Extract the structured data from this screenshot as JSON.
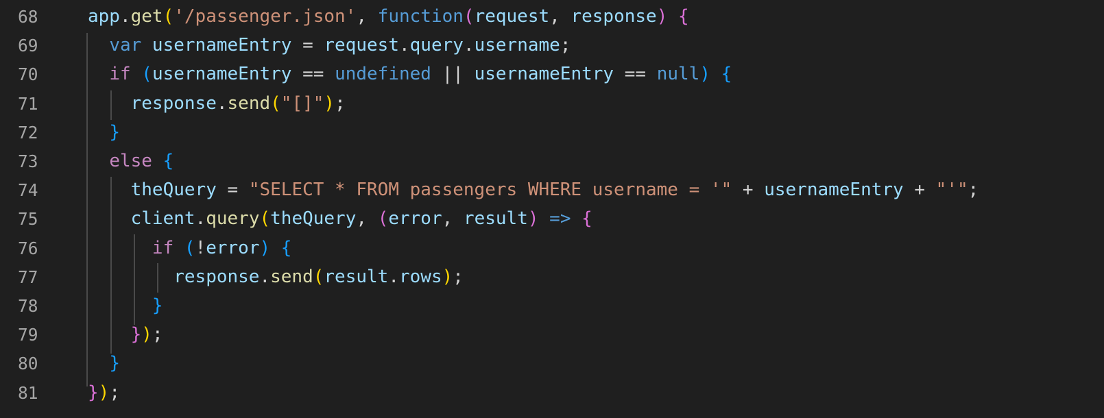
{
  "editor": {
    "language": "javascript",
    "theme_colors": {
      "background": "#1f1f1f",
      "line_number": "#a6a6a6",
      "variable": "#9cdcfe",
      "function": "#dcdcaa",
      "string": "#ce9178",
      "keyword_control": "#c586c0",
      "keyword_storage": "#569cd6",
      "punctuation": "#d4d4d4",
      "bracket_gold": "#ffd700",
      "bracket_pink": "#da70d6",
      "bracket_blue": "#179fff"
    },
    "lines": [
      {
        "number": "68",
        "tokens": [
          {
            "text": "app",
            "kind": "var"
          },
          {
            "text": ".",
            "kind": "punct"
          },
          {
            "text": "get",
            "kind": "func"
          },
          {
            "text": "(",
            "kind": "b1"
          },
          {
            "text": "'/passenger.json'",
            "kind": "str"
          },
          {
            "text": ", ",
            "kind": "punct"
          },
          {
            "text": "function",
            "kind": "storage"
          },
          {
            "text": "(",
            "kind": "b2"
          },
          {
            "text": "request",
            "kind": "var"
          },
          {
            "text": ", ",
            "kind": "punct"
          },
          {
            "text": "response",
            "kind": "var"
          },
          {
            "text": ")",
            "kind": "b2"
          },
          {
            "text": " ",
            "kind": "punct"
          },
          {
            "text": "{",
            "kind": "b2"
          }
        ]
      },
      {
        "number": "69",
        "tokens": [
          {
            "text": "  ",
            "kind": "punct"
          },
          {
            "text": "var",
            "kind": "storage"
          },
          {
            "text": " usernameEntry",
            "kind": "var"
          },
          {
            "text": " = ",
            "kind": "punct"
          },
          {
            "text": "request",
            "kind": "var"
          },
          {
            "text": ".",
            "kind": "punct"
          },
          {
            "text": "query",
            "kind": "var"
          },
          {
            "text": ".",
            "kind": "punct"
          },
          {
            "text": "username",
            "kind": "var"
          },
          {
            "text": ";",
            "kind": "punct"
          }
        ]
      },
      {
        "number": "70",
        "tokens": [
          {
            "text": "  ",
            "kind": "punct"
          },
          {
            "text": "if",
            "kind": "control"
          },
          {
            "text": " ",
            "kind": "punct"
          },
          {
            "text": "(",
            "kind": "b3"
          },
          {
            "text": "usernameEntry",
            "kind": "var"
          },
          {
            "text": " == ",
            "kind": "punct"
          },
          {
            "text": "undefined",
            "kind": "storage"
          },
          {
            "text": " || ",
            "kind": "punct"
          },
          {
            "text": "usernameEntry",
            "kind": "var"
          },
          {
            "text": " == ",
            "kind": "punct"
          },
          {
            "text": "null",
            "kind": "storage"
          },
          {
            "text": ")",
            "kind": "b3"
          },
          {
            "text": " ",
            "kind": "punct"
          },
          {
            "text": "{",
            "kind": "b3"
          }
        ]
      },
      {
        "number": "71",
        "tokens": [
          {
            "text": "    ",
            "kind": "punct"
          },
          {
            "text": "response",
            "kind": "var"
          },
          {
            "text": ".",
            "kind": "punct"
          },
          {
            "text": "send",
            "kind": "func"
          },
          {
            "text": "(",
            "kind": "b1"
          },
          {
            "text": "\"[]\"",
            "kind": "str"
          },
          {
            "text": ")",
            "kind": "b1"
          },
          {
            "text": ";",
            "kind": "punct"
          }
        ]
      },
      {
        "number": "72",
        "tokens": [
          {
            "text": "  ",
            "kind": "punct"
          },
          {
            "text": "}",
            "kind": "b3"
          }
        ]
      },
      {
        "number": "73",
        "tokens": [
          {
            "text": "  ",
            "kind": "punct"
          },
          {
            "text": "else",
            "kind": "control"
          },
          {
            "text": " ",
            "kind": "punct"
          },
          {
            "text": "{",
            "kind": "b3"
          }
        ]
      },
      {
        "number": "74",
        "tokens": [
          {
            "text": "    ",
            "kind": "punct"
          },
          {
            "text": "theQuery",
            "kind": "var"
          },
          {
            "text": " = ",
            "kind": "punct"
          },
          {
            "text": "\"SELECT * FROM passengers WHERE username = '\"",
            "kind": "str"
          },
          {
            "text": " + ",
            "kind": "punct"
          },
          {
            "text": "usernameEntry",
            "kind": "var"
          },
          {
            "text": " + ",
            "kind": "punct"
          },
          {
            "text": "\"'\"",
            "kind": "str"
          },
          {
            "text": ";",
            "kind": "punct"
          }
        ]
      },
      {
        "number": "75",
        "tokens": [
          {
            "text": "    ",
            "kind": "punct"
          },
          {
            "text": "client",
            "kind": "var_blue"
          },
          {
            "text": ".",
            "kind": "punct"
          },
          {
            "text": "query",
            "kind": "func"
          },
          {
            "text": "(",
            "kind": "b1"
          },
          {
            "text": "theQuery",
            "kind": "var"
          },
          {
            "text": ", ",
            "kind": "punct"
          },
          {
            "text": "(",
            "kind": "b2"
          },
          {
            "text": "error",
            "kind": "var"
          },
          {
            "text": ", ",
            "kind": "punct"
          },
          {
            "text": "result",
            "kind": "var"
          },
          {
            "text": ")",
            "kind": "b2"
          },
          {
            "text": " ",
            "kind": "punct"
          },
          {
            "text": "=>",
            "kind": "storage"
          },
          {
            "text": " ",
            "kind": "punct"
          },
          {
            "text": "{",
            "kind": "b2"
          }
        ]
      },
      {
        "number": "76",
        "tokens": [
          {
            "text": "      ",
            "kind": "punct"
          },
          {
            "text": "if",
            "kind": "control"
          },
          {
            "text": " ",
            "kind": "punct"
          },
          {
            "text": "(",
            "kind": "b3"
          },
          {
            "text": "!",
            "kind": "punct"
          },
          {
            "text": "error",
            "kind": "var"
          },
          {
            "text": ")",
            "kind": "b3"
          },
          {
            "text": " ",
            "kind": "punct"
          },
          {
            "text": "{",
            "kind": "b3"
          }
        ]
      },
      {
        "number": "77",
        "tokens": [
          {
            "text": "        ",
            "kind": "punct"
          },
          {
            "text": "response",
            "kind": "var"
          },
          {
            "text": ".",
            "kind": "punct"
          },
          {
            "text": "send",
            "kind": "func"
          },
          {
            "text": "(",
            "kind": "b1"
          },
          {
            "text": "result",
            "kind": "var"
          },
          {
            "text": ".",
            "kind": "punct"
          },
          {
            "text": "rows",
            "kind": "var"
          },
          {
            "text": ")",
            "kind": "b1"
          },
          {
            "text": ";",
            "kind": "punct"
          }
        ]
      },
      {
        "number": "78",
        "tokens": [
          {
            "text": "      ",
            "kind": "punct"
          },
          {
            "text": "}",
            "kind": "b3"
          }
        ]
      },
      {
        "number": "79",
        "tokens": [
          {
            "text": "    ",
            "kind": "punct"
          },
          {
            "text": "}",
            "kind": "b2"
          },
          {
            "text": ")",
            "kind": "b1"
          },
          {
            "text": ";",
            "kind": "punct"
          }
        ]
      },
      {
        "number": "80",
        "tokens": [
          {
            "text": "  ",
            "kind": "punct"
          },
          {
            "text": "}",
            "kind": "b3"
          }
        ]
      },
      {
        "number": "81",
        "tokens": [
          {
            "text": "}",
            "kind": "b2"
          },
          {
            "text": ")",
            "kind": "b1"
          },
          {
            "text": ";",
            "kind": "punct"
          }
        ]
      }
    ]
  }
}
